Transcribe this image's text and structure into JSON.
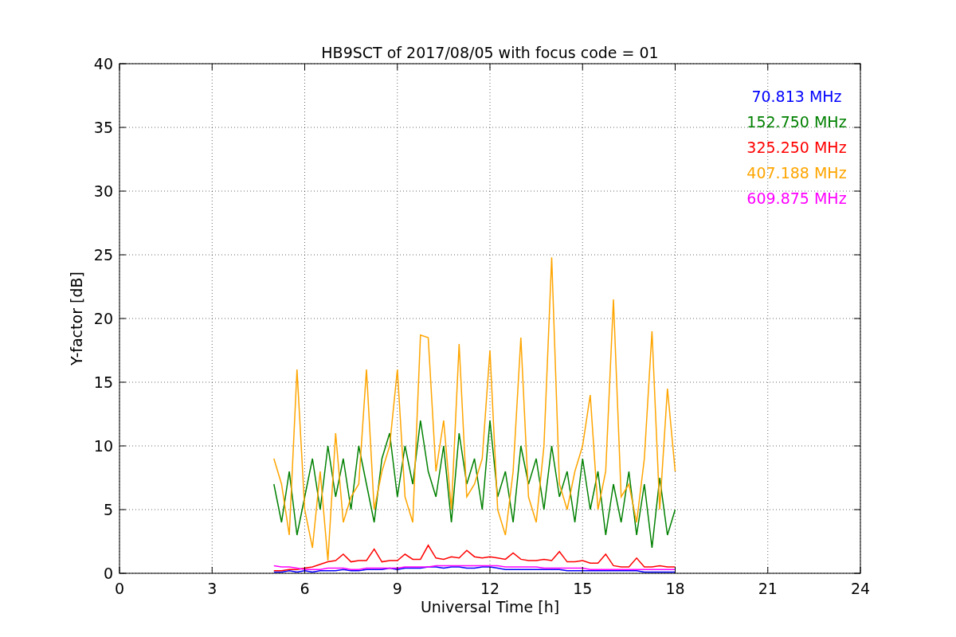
{
  "chart_data": {
    "type": "line",
    "grid": true,
    "title": "HB9SCT of 2017/08/05 with focus code = 01",
    "xlabel": "Universal Time [h]",
    "ylabel": "Y-factor [dB]",
    "xlim": [
      0,
      24
    ],
    "ylim": [
      0,
      40
    ],
    "xticks": [
      0,
      3,
      6,
      9,
      12,
      15,
      18,
      21,
      24
    ],
    "yticks": [
      0,
      5,
      10,
      15,
      20,
      25,
      30,
      35,
      40
    ],
    "x": [
      5,
      5.25,
      5.5,
      5.75,
      6,
      6.25,
      6.5,
      6.75,
      7,
      7.25,
      7.5,
      7.75,
      8,
      8.25,
      8.5,
      8.75,
      9,
      9.25,
      9.5,
      9.75,
      10,
      10.25,
      10.5,
      10.75,
      11,
      11.25,
      11.5,
      11.75,
      12,
      12.25,
      12.5,
      12.75,
      13,
      13.25,
      13.5,
      13.75,
      14,
      14.25,
      14.5,
      14.75,
      15,
      15.25,
      15.5,
      15.75,
      16,
      16.25,
      16.5,
      16.75,
      17,
      17.25,
      17.5,
      17.75,
      18
    ],
    "series": [
      {
        "name": "70.813 MHz",
        "color": "#0000ff",
        "values": [
          0.1,
          0.1,
          0.2,
          0.1,
          0.2,
          0.1,
          0.2,
          0.2,
          0.2,
          0.3,
          0.2,
          0.2,
          0.3,
          0.3,
          0.3,
          0.4,
          0.3,
          0.4,
          0.4,
          0.4,
          0.5,
          0.5,
          0.4,
          0.5,
          0.5,
          0.4,
          0.4,
          0.5,
          0.5,
          0.4,
          0.3,
          0.3,
          0.3,
          0.3,
          0.3,
          0.3,
          0.3,
          0.3,
          0.2,
          0.2,
          0.2,
          0.2,
          0.2,
          0.2,
          0.2,
          0.2,
          0.2,
          0.2,
          0.1,
          0.1,
          0.1,
          0.1,
          0.1
        ]
      },
      {
        "name": "152.750 MHz",
        "color": "#008000",
        "values": [
          7,
          4,
          8,
          3,
          6,
          9,
          5,
          10,
          6,
          9,
          5,
          10,
          7,
          4,
          9,
          11,
          6,
          10,
          7,
          12,
          8,
          6,
          10,
          4,
          11,
          7,
          9,
          5,
          12,
          6,
          8,
          4,
          10,
          7,
          9,
          5,
          10,
          6,
          8,
          4,
          9,
          5,
          8,
          3,
          7,
          4,
          8,
          3,
          7,
          2,
          7.5,
          3,
          5
        ]
      },
      {
        "name": "325.250 MHz",
        "color": "#ff0000",
        "values": [
          0.2,
          0.2,
          0.3,
          0.3,
          0.4,
          0.5,
          0.7,
          0.9,
          1.0,
          1.5,
          0.9,
          1.0,
          1.0,
          1.9,
          0.9,
          1.0,
          1.0,
          1.5,
          1.1,
          1.1,
          2.2,
          1.2,
          1.1,
          1.3,
          1.2,
          1.8,
          1.3,
          1.2,
          1.3,
          1.2,
          1.1,
          1.6,
          1.1,
          1.0,
          1.0,
          1.1,
          1.0,
          1.7,
          0.9,
          0.9,
          1.0,
          0.8,
          0.8,
          1.5,
          0.6,
          0.5,
          0.5,
          1.2,
          0.5,
          0.5,
          0.6,
          0.5,
          0.5
        ]
      },
      {
        "name": "407.188 MHz",
        "color": "#ffa500",
        "values": [
          9,
          7,
          3,
          16,
          5,
          2,
          8,
          1,
          11,
          4,
          6,
          7,
          16,
          5,
          8,
          10,
          16,
          6,
          4,
          18.7,
          18.5,
          8,
          12,
          5,
          18,
          6,
          7,
          9,
          17.5,
          5,
          3,
          8,
          18.5,
          6,
          4,
          10,
          24.8,
          7,
          5,
          8,
          10,
          14,
          5,
          8,
          21.5,
          6,
          7,
          4,
          9,
          19,
          5,
          14.5,
          8
        ]
      },
      {
        "name": "609.875 MHz",
        "color": "#ff00ff",
        "values": [
          0.6,
          0.5,
          0.5,
          0.4,
          0.3,
          0.3,
          0.3,
          0.4,
          0.4,
          0.4,
          0.3,
          0.3,
          0.4,
          0.4,
          0.4,
          0.4,
          0.4,
          0.5,
          0.5,
          0.5,
          0.5,
          0.6,
          0.6,
          0.6,
          0.6,
          0.6,
          0.6,
          0.6,
          0.6,
          0.6,
          0.5,
          0.5,
          0.5,
          0.5,
          0.5,
          0.4,
          0.4,
          0.4,
          0.4,
          0.4,
          0.4,
          0.3,
          0.3,
          0.3,
          0.3,
          0.3,
          0.3,
          0.3,
          0.3,
          0.3,
          0.3,
          0.3,
          0.3
        ]
      }
    ]
  }
}
